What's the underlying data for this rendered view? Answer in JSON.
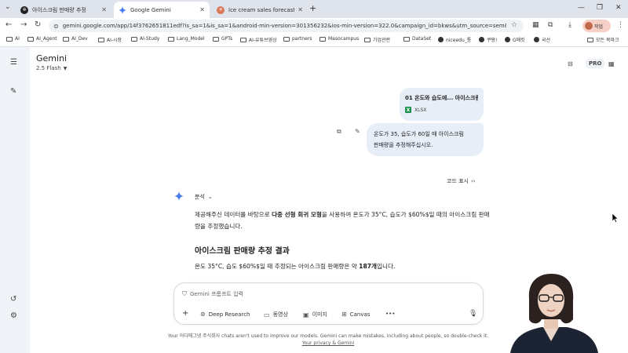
{
  "tabs": [
    {
      "label": "아이스크림 판매량 추정",
      "active": false,
      "favicon": "chatgpt-icon"
    },
    {
      "label": "Google Gemini",
      "active": true,
      "favicon": "gemini-icon"
    },
    {
      "label": "Ice cream sales forecast - Cla",
      "active": false,
      "favicon": "claude-icon"
    }
  ],
  "toolbar": {
    "url": "gemini.google.com/app/14f3762651811edf?is_sa=1&is_sa=1&android-min-version=301356232&ios-min-version=322.0&campaign_id=bkws&utm_source=sem&utm_so...",
    "profile_label": "작업"
  },
  "bookmarks": [
    {
      "label": "AI",
      "icon": "folder-icon"
    },
    {
      "label": "AI_Agent",
      "icon": "folder-icon"
    },
    {
      "label": "AI_Dev",
      "icon": "folder-icon"
    },
    {
      "label": "AI-시장",
      "icon": "folder-icon"
    },
    {
      "label": "AI-Study",
      "icon": "folder-icon"
    },
    {
      "label": "Lang_Model",
      "icon": "folder-icon"
    },
    {
      "label": "GPTs",
      "icon": "folder-icon"
    },
    {
      "label": "AI-유튜브영상",
      "icon": "folder-icon"
    },
    {
      "label": "partners",
      "icon": "folder-icon"
    },
    {
      "label": "Masocampus",
      "icon": "folder-icon"
    },
    {
      "label": "기업관련",
      "icon": "folder-icon"
    },
    {
      "label": "DataSet",
      "icon": "folder-icon"
    },
    {
      "label": "niceedu_통",
      "icon": "globe-icon"
    },
    {
      "label": "쿠팡!",
      "icon": "globe-icon"
    },
    {
      "label": "G메킷",
      "icon": "globe-icon"
    },
    {
      "label": "국선",
      "icon": "globe-icon"
    },
    {
      "label": "모든 북마크",
      "icon": "folder-icon"
    }
  ],
  "app": {
    "brand": "Gemini",
    "model": "2.5 Flash",
    "pro_badge": "PRO"
  },
  "chat": {
    "file": {
      "name": "01 온도와 습도에... 아이스크림 판",
      "type": "XLSX"
    },
    "user_query_line1": "온도가 35, 습도가 60일 때 아이스크림",
    "user_query_line2": "판매량을 추정해주십시오.",
    "code_toggle": "코드 표시",
    "analysis_label": "분석",
    "para_part1": "제공해주신 데이터를 바탕으로 ",
    "para_bold": "다중 선형 회귀 모형",
    "para_part2": "을 사용하여 온도가 35°C, 습도가 $60%$일 때의 아이스크림 판매량을 추정했습니다.",
    "heading": "아이스크림 판매량 추정 결과",
    "result_part1": "온도 35°C, 습도 $60%$일 때 추정되는 아이스크림 판매량은 약 ",
    "result_bold": "187개",
    "result_part2": "입니다."
  },
  "composer": {
    "placeholder": "Gemini 프롬프트 입력",
    "tools": [
      {
        "label": "Deep Research",
        "icon": "deep-research-icon"
      },
      {
        "label": "동영상",
        "icon": "video-icon"
      },
      {
        "label": "이미지",
        "icon": "image-icon"
      },
      {
        "label": "Canvas",
        "icon": "canvas-icon"
      }
    ]
  },
  "disclaimer": {
    "line1": "Your 어디메그넷 주식회사 chats aren't used to improve our models. Gemini can make mistakes, including about people, so double-check it.",
    "link": "Your privacy & Gemini"
  },
  "colors": {
    "accent": "#1a73e8",
    "bubble": "#e8eef7",
    "sidebar": "#f0f3f8",
    "xlsx": "#1d8f4d"
  }
}
